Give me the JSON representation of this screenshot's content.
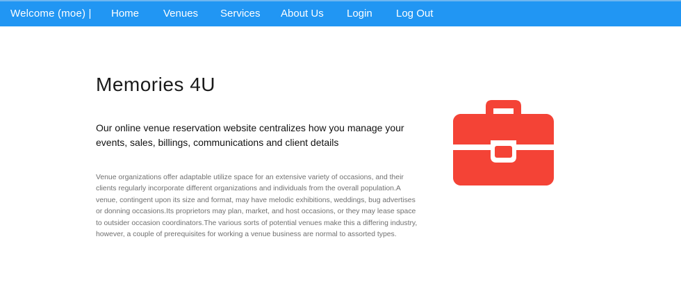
{
  "nav": {
    "welcome": "Welcome (moe) |",
    "items": [
      {
        "label": "Home"
      },
      {
        "label": "Venues"
      },
      {
        "label": "Services"
      },
      {
        "label": "About Us"
      },
      {
        "label": "Login"
      },
      {
        "label": "Log Out"
      }
    ]
  },
  "hero": {
    "title": "Memories 4U",
    "subtitle": "Our online venue reservation website centralizes how you manage your events, sales, billings, communications and client details",
    "body": "Venue organizations offer adaptable utilize space for an extensive variety of occasions, and their clients regularly incorporate different organizations and individuals from the overall population.A venue, contingent upon its size and format, may have melodic exhibitions, weddings, bug advertises or donning occasions.Its proprietors may plan, market, and host occasions, or they may lease space to outsider occasion coordinators.The various sorts of potential venues make this a differing industry, however, a couple of prerequisites for working a venue business are normal to assorted types.",
    "icon": "briefcase-icon"
  },
  "colors": {
    "navbar": "#2196f3",
    "icon": "#f44336"
  }
}
